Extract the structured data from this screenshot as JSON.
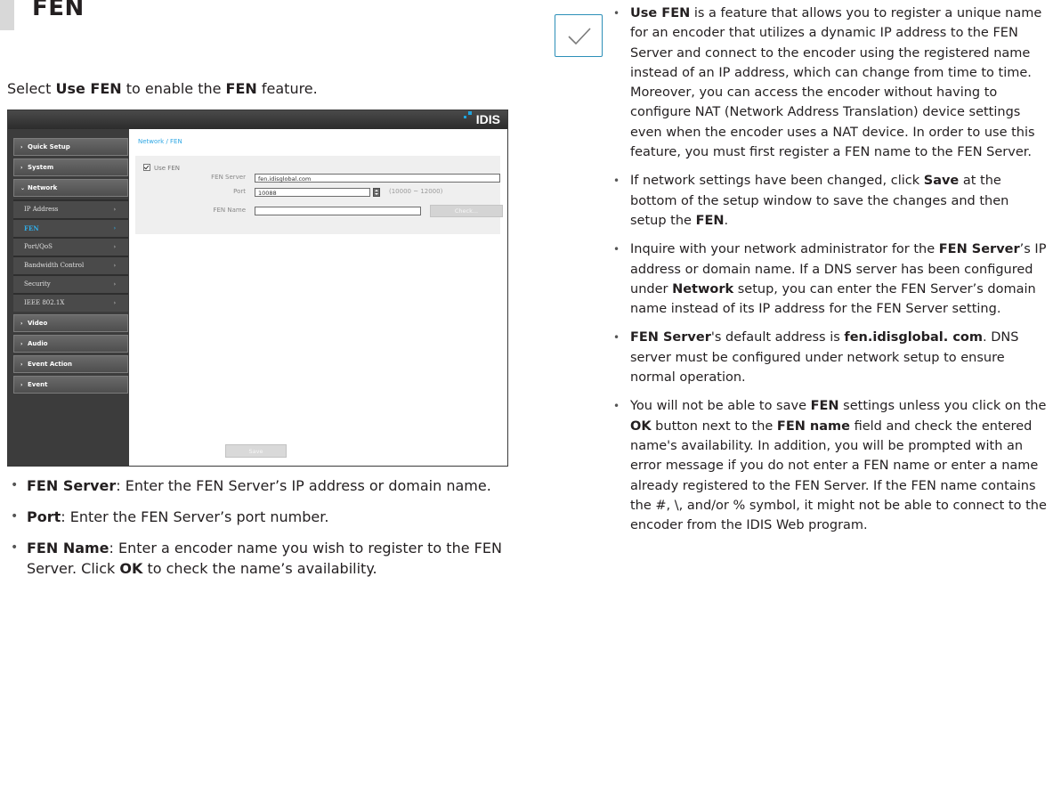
{
  "header": {
    "title": "FEN",
    "intro": {
      "pre": "Select ",
      "b1": "Use FEN",
      "mid": " to enable the ",
      "b2": "FEN",
      "post": " feature."
    }
  },
  "screenshot": {
    "logo": "IDIS",
    "breadcrumb": "Network / FEN",
    "menu": {
      "quick_setup": "Quick Setup",
      "system": "System",
      "network": "Network",
      "network_items": [
        "IP Address",
        "FEN",
        "Port/QoS",
        "Bandwidth Control",
        "Security",
        "IEEE 802.1X"
      ],
      "video": "Video",
      "audio": "Audio",
      "event_action": "Event Action",
      "event": "Event"
    },
    "form": {
      "use_fen_label": "Use FEN",
      "use_fen_checked": true,
      "fen_server_label": "FEN Server",
      "fen_server_value": "fen.idisglobal.com",
      "port_label": "Port",
      "port_value": "10088",
      "port_range": "(10000 ~ 12000)",
      "fen_name_label": "FEN Name",
      "fen_name_value": "",
      "check_button": "Check...",
      "save_button": "Save"
    },
    "accent_color": "#31aee9"
  },
  "left_bullets": [
    {
      "b": "FEN Server",
      "t": ": Enter the FEN Server’s IP address or domain name."
    },
    {
      "b": "Port",
      "t": ": Enter the FEN Server’s port number."
    },
    {
      "b": "FEN Name",
      "t1": ": Enter a encoder name you wish to register to the FEN Server. Click ",
      "b2": "OK",
      "t2": " to check the name’s availability."
    }
  ],
  "notes": {
    "icon": "checkmark-icon",
    "n1": {
      "b": "Use FEN",
      "t": " is a feature that allows you to register a unique name for an encoder that utilizes a dynamic IP address to the FEN Server and connect to the encoder using the registered name instead of an IP address, which can change from time to time. Moreover, you can access the encoder without having to configure NAT (Network Address Translation) device settings even when the encoder uses a NAT device. In order to use this feature, you must first register a FEN name to the FEN Server."
    },
    "n2": {
      "t1": "If network settings have been changed, click ",
      "b1": "Save",
      "t2": " at the bottom of the setup window to save the changes and then setup the ",
      "b2": "FEN",
      "t3": "."
    },
    "n3": {
      "t1": "Inquire with your network administrator for the ",
      "b1": "FEN Server",
      "t2": "’s IP address or domain name. If a DNS server has been configured under ",
      "b2": "Network",
      "t3": " setup, you can enter the FEN Server’s domain name instead of its IP address for the FEN Server setting."
    },
    "n4": {
      "b1": "FEN Server",
      "t1": "'s default address is ",
      "b2": "fen.idisglobal. com",
      "t2": ". DNS server must be configured under network setup to ensure normal operation."
    },
    "n5": {
      "t1": "You will not be able to save ",
      "b1": "FEN",
      "t2": " settings unless you click on the ",
      "b2": "OK",
      "t3": " button next to the ",
      "b3": "FEN name",
      "t4": " field and check the entered name's availability. In addition, you will be prompted with an error message if you do not enter a FEN name or enter a name already registered to the FEN Server. If the FEN name contains the #, \\, and/or % symbol, it might not be able to connect to the encoder from the IDIS Web program."
    }
  }
}
